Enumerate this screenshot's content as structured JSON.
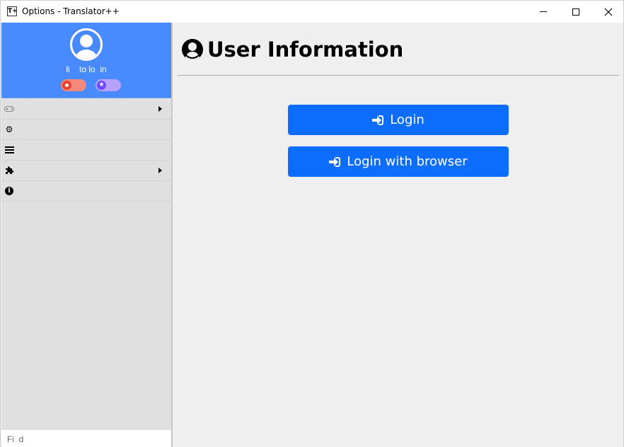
{
  "window": {
    "title": "Options - Translator++",
    "app_icon_text": "T+"
  },
  "sidebar": {
    "profile": {
      "login_link": "li    to lo  in"
    },
    "menu": [
      {
        "icon": "gamepad-icon",
        "has_submenu": true
      },
      {
        "icon": "gear-icon",
        "has_submenu": false
      },
      {
        "icon": "list-icon",
        "has_submenu": false
      },
      {
        "icon": "puzzle-icon",
        "has_submenu": true
      },
      {
        "icon": "info-icon",
        "has_submenu": false
      }
    ],
    "find_placeholder": "Fi  d"
  },
  "main": {
    "heading": "User Information",
    "buttons": {
      "login": "Login",
      "login_browser": "Login with browser"
    }
  },
  "colors": {
    "profile_bg": "#4a8aff",
    "button_bg": "#0d6efd",
    "toggle_red": "#e8412f",
    "toggle_purple": "#6b4cff"
  }
}
